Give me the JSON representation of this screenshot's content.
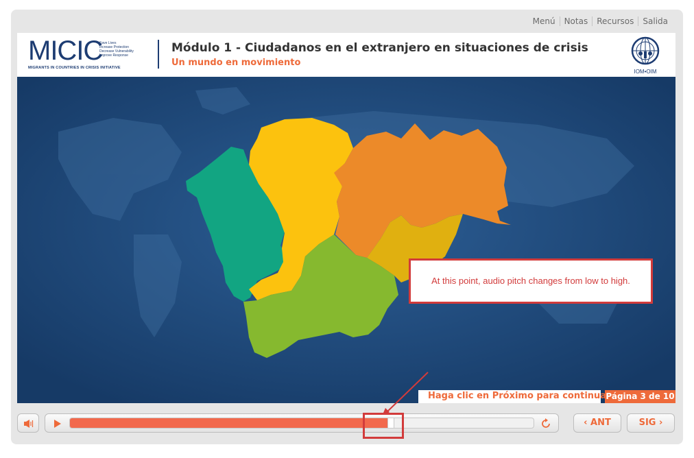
{
  "nav": {
    "items": [
      "Menú",
      "Notas",
      "Recursos",
      "Salida"
    ]
  },
  "logo": {
    "name": "MICIC",
    "taglines": [
      "Save Lives",
      "Increase Protection",
      "Decrease Vulnerability",
      "Improve Response"
    ],
    "subline": "MIGRANTS IN COUNTRIES IN CRISIS INITIATIVE"
  },
  "header": {
    "title": "Módulo 1 - Ciudadanos en el extranjero en situaciones de crisis",
    "subtitle": "Un mundo en movimiento"
  },
  "partner_logo": {
    "label": "IOM•OIM"
  },
  "callout": {
    "text": "At this point, audio pitch changes from low to high."
  },
  "footer": {
    "continue_text": "Haga clic en Próximo para continuar",
    "page_label": "Página 3 de 10"
  },
  "controls": {
    "prev_label": "ANT",
    "next_label": "SIG",
    "progress": 0.685
  },
  "colors": {
    "accent": "#ee6a3a",
    "brand": "#1d3c72",
    "callout": "#d23b3b",
    "stage": "#1f4a7d",
    "region_teal": "#12a582",
    "region_yellow": "#fcc20e",
    "region_orange": "#ec8a29",
    "region_gold": "#e0b010",
    "region_green": "#86b92f"
  }
}
